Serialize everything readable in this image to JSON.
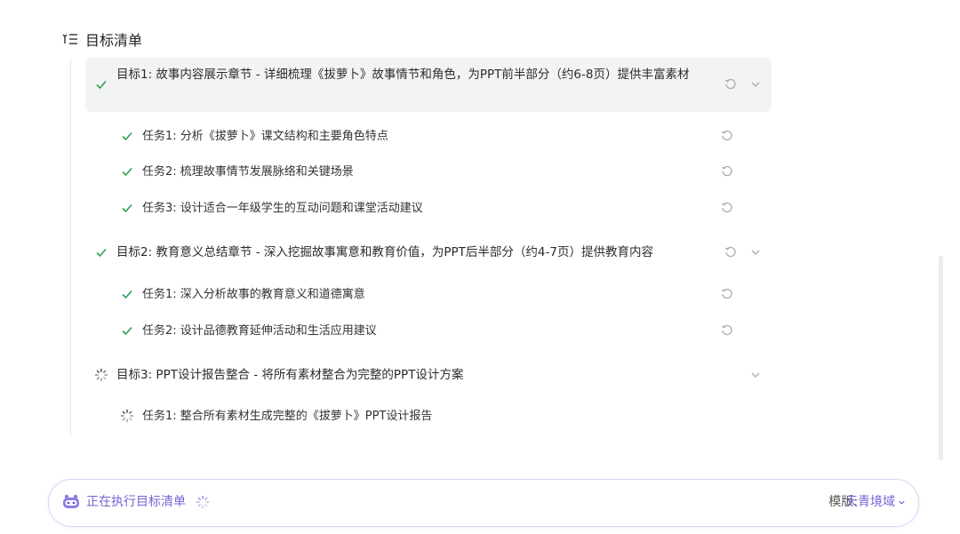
{
  "header": {
    "title": "目标清单"
  },
  "goals": [
    {
      "label": "目标1: 故事内容展示章节 - 详细梳理《拔萝卜》故事情节和角色，为PPT前半部分（约6-8页）提供丰富素材",
      "status": "done",
      "tasks": [
        {
          "label": "任务1: 分析《拔萝卜》课文结构和主要角色特点",
          "status": "done"
        },
        {
          "label": "任务2: 梳理故事情节发展脉络和关键场景",
          "status": "done"
        },
        {
          "label": "任务3: 设计适合一年级学生的互动问题和课堂活动建议",
          "status": "done"
        }
      ]
    },
    {
      "label": "目标2: 教育意义总结章节 - 深入挖掘故事寓意和教育价值，为PPT后半部分（约4-7页）提供教育内容",
      "status": "done",
      "tasks": [
        {
          "label": "任务1: 深入分析故事的教育意义和道德寓意",
          "status": "done"
        },
        {
          "label": "任务2: 设计品德教育延伸活动和生活应用建议",
          "status": "done"
        }
      ]
    },
    {
      "label": "目标3: PPT设计报告整合 - 将所有素材整合为完整的PPT设计方案",
      "status": "running",
      "tasks": [
        {
          "label": "任务1: 整合所有素材生成完整的《拔萝卜》PPT设计报告",
          "status": "running"
        }
      ]
    }
  ],
  "bottom_bar": {
    "status_text": "正在执行目标清单",
    "template_label": "模版:",
    "template_value": "天青境域"
  },
  "colors": {
    "check": "#2e9e52",
    "accent": "#7a63d6",
    "icon_gray": "#9a9a9a"
  },
  "icons": [
    "list-icon",
    "check-icon",
    "spinner-icon",
    "retry-icon",
    "chevron-down-icon",
    "robot-icon"
  ]
}
